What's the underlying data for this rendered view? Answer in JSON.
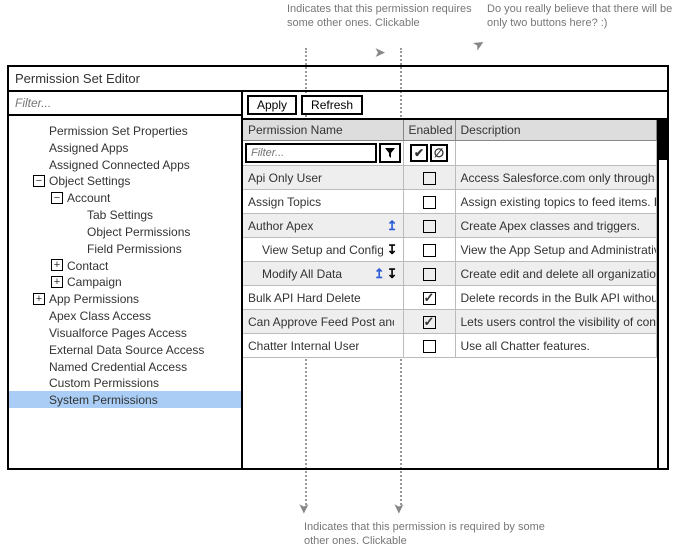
{
  "annotations": {
    "top_left": "Indicates that this permission requires some other ones. Clickable",
    "top_right": "Do you really believe that there will be only two buttons here? :)",
    "bottom": "Indicates that this permission is required by some other ones. Clickable"
  },
  "editor": {
    "title": "Permission Set Editor",
    "sidebar": {
      "filter_placeholder": "Filter...",
      "tree": [
        {
          "label": "Permission Set Properties",
          "depth": 0,
          "expander": null
        },
        {
          "label": "Assigned Apps",
          "depth": 0,
          "expander": null
        },
        {
          "label": "Assigned Connected Apps",
          "depth": 0,
          "expander": null
        },
        {
          "label": "Object Settings",
          "depth": 0,
          "expander": "minus"
        },
        {
          "label": "Account",
          "depth": 1,
          "expander": "minus"
        },
        {
          "label": "Tab Settings",
          "depth": 2,
          "expander": null
        },
        {
          "label": "Object Permissions",
          "depth": 2,
          "expander": null
        },
        {
          "label": "Field Permissions",
          "depth": 2,
          "expander": null
        },
        {
          "label": "Contact",
          "depth": 1,
          "expander": "plus"
        },
        {
          "label": "Campaign",
          "depth": 1,
          "expander": "plus"
        },
        {
          "label": "App Permissions",
          "depth": 0,
          "expander": "plus"
        },
        {
          "label": "Apex Class Access",
          "depth": 0,
          "expander": null
        },
        {
          "label": "Visualforce Pages Access",
          "depth": 0,
          "expander": null
        },
        {
          "label": "External Data Source Access",
          "depth": 0,
          "expander": null
        },
        {
          "label": "Named Credential Access",
          "depth": 0,
          "expander": null
        },
        {
          "label": "Custom Permissions",
          "depth": 0,
          "expander": null
        },
        {
          "label": "System Permissions",
          "depth": 0,
          "expander": null,
          "selected": true
        }
      ]
    },
    "toolbar": {
      "apply_label": "Apply",
      "refresh_label": "Refresh"
    },
    "table": {
      "headers": {
        "name": "Permission Name",
        "enabled": "Enabled",
        "desc": "Description"
      },
      "name_filter_placeholder": "Filter...",
      "enabled_filter": {
        "check": "✔",
        "block": "∅"
      },
      "rows": [
        {
          "name": "Api Only User",
          "indent": 0,
          "dep_up": false,
          "dep_down": false,
          "enabled": false,
          "desc": "Access Salesforce.com only through a S"
        },
        {
          "name": "Assign Topics",
          "indent": 0,
          "dep_up": false,
          "dep_down": false,
          "enabled": false,
          "desc": "Assign existing topics to feed items. Re"
        },
        {
          "name": "Author Apex",
          "indent": 0,
          "dep_up": true,
          "dep_down": false,
          "enabled": false,
          "desc": "Create Apex classes and triggers."
        },
        {
          "name": "View Setup and Config",
          "indent": 1,
          "dep_up": false,
          "dep_down": true,
          "enabled": false,
          "desc": "View the App Setup and Administrative S"
        },
        {
          "name": "Modify All Data",
          "indent": 1,
          "dep_up": true,
          "dep_down": true,
          "enabled": false,
          "desc": "Create edit and delete all organization d"
        },
        {
          "name": "Bulk API Hard Delete",
          "indent": 0,
          "dep_up": false,
          "dep_down": false,
          "enabled": true,
          "desc": "Delete records in the Bulk API without s"
        },
        {
          "name": "Can Approve Feed Post and Co",
          "indent": 0,
          "dep_up": false,
          "dep_down": false,
          "enabled": true,
          "desc": "Lets users control the visibility of conte"
        },
        {
          "name": "Chatter Internal User",
          "indent": 0,
          "dep_up": false,
          "dep_down": false,
          "enabled": false,
          "desc": "Use all Chatter features."
        }
      ]
    }
  }
}
